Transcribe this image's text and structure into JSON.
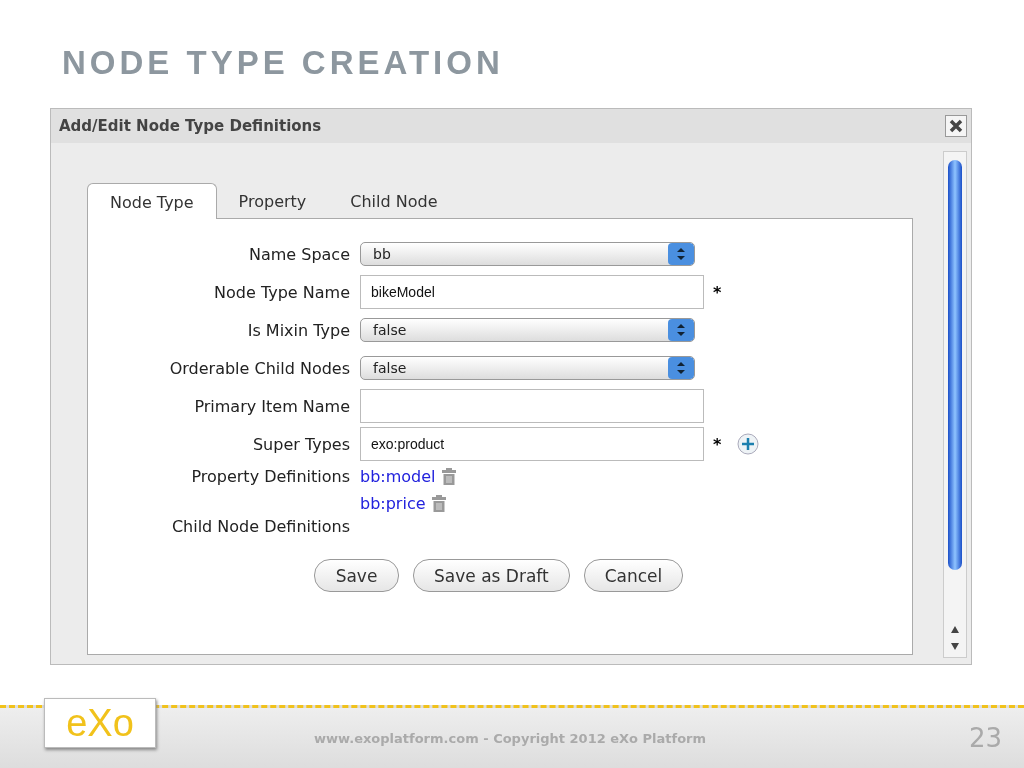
{
  "slide_title": "NODE TYPE CREATION",
  "dialog": {
    "title": "Add/Edit Node Type Definitions",
    "tabs": [
      {
        "label": "Node Type",
        "selected": true
      },
      {
        "label": "Property",
        "selected": false
      },
      {
        "label": "Child Node",
        "selected": false
      }
    ],
    "fields": [
      {
        "kind": "select",
        "label": "Name Space",
        "value": "bb"
      },
      {
        "kind": "input",
        "label": "Node Type Name",
        "value": "bikeModel",
        "required": "*"
      },
      {
        "kind": "select",
        "label": "Is Mixin Type",
        "value": "false"
      },
      {
        "kind": "select",
        "label": "Orderable Child Nodes",
        "value": "false"
      },
      {
        "kind": "input",
        "label": "Primary Item Name"
      },
      {
        "kind": "input",
        "label": "Super Types",
        "value": "exo:product",
        "required": "*",
        "add": true
      },
      {
        "kind": "links",
        "label": "Property Definitions",
        "links": [
          "bb:model",
          "bb:price"
        ]
      },
      {
        "kind": "links",
        "label": "Child Node Definitions"
      }
    ],
    "buttons": [
      "Save",
      "Save as Draft",
      "Cancel"
    ]
  },
  "footer": {
    "logo": "eXo",
    "copyright": "www.exoplatform.com - Copyright 2012 eXo Platform",
    "page_number": "23"
  }
}
